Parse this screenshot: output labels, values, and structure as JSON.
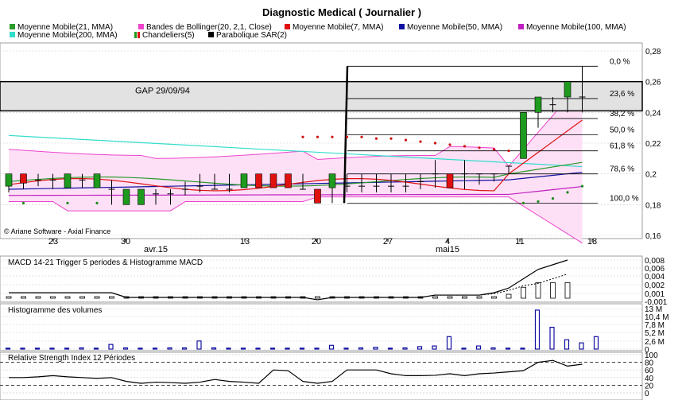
{
  "chart_data": {
    "type": "candlestick",
    "title": "Diagnostic Medical  ( Journalier )",
    "copyright": "© Ariane Software - Axial Finance",
    "colors": {
      "mm21": "#2a9a2a",
      "bollinger": "#ee44cc",
      "bollinger_fill": "#fde0f6",
      "mm7": "#e01010",
      "mm50": "#1010a0",
      "mm100": "#c020c0",
      "mm200": "#33ddcc",
      "candle_up": "#1e9a1e",
      "candle_down": "#e01010",
      "sar": "#000000"
    },
    "legend": {
      "row1": [
        {
          "key": "mm21",
          "label": "Moyenne Mobile(21, MMA)"
        },
        {
          "key": "bollinger",
          "label": "Bandes de Bollinger(20, 2,1, Close)"
        },
        {
          "key": "mm7",
          "label": "Moyenne Mobile(7, MMA)"
        },
        {
          "key": "mm50",
          "label": "Moyenne Mobile(50, MMA)"
        },
        {
          "key": "mm100",
          "label": "Moyenne Mobile(100, MMA)"
        }
      ],
      "row2": [
        {
          "key": "mm200",
          "label": "Moyenne Mobile(200, MMA)"
        },
        {
          "key": "candles",
          "label": "Chandeliers(5)"
        },
        {
          "key": "sar",
          "label": "Parabolique SAR(2)"
        }
      ]
    },
    "price_axis": {
      "ticks": [
        "0,28",
        "0,26",
        "0,24",
        "0,22",
        "0,2",
        "0,18",
        "0,16"
      ],
      "ylim": [
        0.16,
        0.29
      ]
    },
    "x_axis": {
      "ticks": [
        "23",
        "30",
        "13",
        "20",
        "27",
        "4",
        "11",
        "18"
      ],
      "months": [
        "avr.15",
        "mai15"
      ]
    },
    "gap_label": "GAP 29/09/94",
    "gap_range": [
      0.241,
      0.26
    ],
    "fibonacci": {
      "low": 0.181,
      "high": 0.27,
      "levels": [
        {
          "label": "0,0 %",
          "value": 0.27
        },
        {
          "label": "23,6 %",
          "value": 0.249
        },
        {
          "label": "38,2 %",
          "value": 0.236
        },
        {
          "label": "50,0 %",
          "value": 0.2255
        },
        {
          "label": "61,8 %",
          "value": 0.215
        },
        {
          "label": "78,6 %",
          "value": 0.2
        },
        {
          "label": "100,0 %",
          "value": 0.181
        }
      ]
    },
    "candles": [
      {
        "o": 0.192,
        "h": 0.2,
        "l": 0.188,
        "c": 0.2
      },
      {
        "o": 0.2,
        "h": 0.2,
        "l": 0.19,
        "c": 0.194
      },
      {
        "o": 0.196,
        "h": 0.2,
        "l": 0.192,
        "c": 0.196
      },
      {
        "o": 0.196,
        "h": 0.2,
        "l": 0.19,
        "c": 0.196
      },
      {
        "o": 0.191,
        "h": 0.2,
        "l": 0.191,
        "c": 0.2
      },
      {
        "o": 0.196,
        "h": 0.2,
        "l": 0.191,
        "c": 0.196
      },
      {
        "o": 0.191,
        "h": 0.2,
        "l": 0.191,
        "c": 0.2
      },
      {
        "o": 0.19,
        "h": 0.196,
        "l": 0.18,
        "c": 0.19
      },
      {
        "o": 0.18,
        "h": 0.19,
        "l": 0.18,
        "c": 0.19
      },
      {
        "o": 0.18,
        "h": 0.19,
        "l": 0.18,
        "c": 0.19
      },
      {
        "o": 0.187,
        "h": 0.19,
        "l": 0.18,
        "c": 0.187
      },
      {
        "o": 0.187,
        "h": 0.19,
        "l": 0.18,
        "c": 0.187
      },
      {
        "o": 0.19,
        "h": 0.195,
        "l": 0.186,
        "c": 0.19
      },
      {
        "o": 0.192,
        "h": 0.2,
        "l": 0.188,
        "c": 0.192
      },
      {
        "o": 0.19,
        "h": 0.2,
        "l": 0.19,
        "c": 0.19
      },
      {
        "o": 0.19,
        "h": 0.2,
        "l": 0.188,
        "c": 0.19
      },
      {
        "o": 0.191,
        "h": 0.2,
        "l": 0.191,
        "c": 0.2
      },
      {
        "o": 0.2,
        "h": 0.2,
        "l": 0.191,
        "c": 0.191
      },
      {
        "o": 0.2,
        "h": 0.2,
        "l": 0.191,
        "c": 0.191
      },
      {
        "o": 0.2,
        "h": 0.2,
        "l": 0.191,
        "c": 0.191
      },
      {
        "o": 0.19,
        "h": 0.2,
        "l": 0.19,
        "c": 0.19
      },
      {
        "o": 0.19,
        "h": 0.19,
        "l": 0.181,
        "c": 0.181
      },
      {
        "o": 0.191,
        "h": 0.2,
        "l": 0.181,
        "c": 0.2
      },
      {
        "o": 0.192,
        "h": 0.2,
        "l": 0.188,
        "c": 0.192
      },
      {
        "o": 0.192,
        "h": 0.2,
        "l": 0.188,
        "c": 0.192
      },
      {
        "o": 0.192,
        "h": 0.2,
        "l": 0.188,
        "c": 0.192
      },
      {
        "o": 0.192,
        "h": 0.2,
        "l": 0.188,
        "c": 0.192
      },
      {
        "o": 0.192,
        "h": 0.2,
        "l": 0.188,
        "c": 0.192
      },
      {
        "o": 0.195,
        "h": 0.2,
        "l": 0.19,
        "c": 0.195
      },
      {
        "o": 0.2,
        "h": 0.209,
        "l": 0.191,
        "c": 0.2
      },
      {
        "o": 0.2,
        "h": 0.2,
        "l": 0.191,
        "c": 0.191
      },
      {
        "o": 0.2,
        "h": 0.209,
        "l": 0.19,
        "c": 0.2
      },
      {
        "o": 0.2,
        "h": 0.2,
        "l": 0.193,
        "c": 0.2
      },
      {
        "o": 0.2,
        "h": 0.2,
        "l": 0.195,
        "c": 0.2
      },
      {
        "o": 0.205,
        "h": 0.205,
        "l": 0.2,
        "c": 0.205
      },
      {
        "o": 0.21,
        "h": 0.24,
        "l": 0.21,
        "c": 0.24
      },
      {
        "o": 0.24,
        "h": 0.25,
        "l": 0.23,
        "c": 0.25
      },
      {
        "o": 0.245,
        "h": 0.25,
        "l": 0.24,
        "c": 0.245
      },
      {
        "o": 0.25,
        "h": 0.26,
        "l": 0.24,
        "c": 0.26
      },
      {
        "o": 0.25,
        "h": 0.27,
        "l": 0.24,
        "c": 0.25
      }
    ],
    "sar": [
      null,
      0.181,
      null,
      null,
      0.181,
      null,
      0.181,
      null,
      null,
      null,
      null,
      null,
      null,
      null,
      null,
      null,
      null,
      null,
      null,
      null,
      0.224,
      0.224,
      0.224,
      0.224,
      0.224,
      0.223,
      0.223,
      0.222,
      0.221,
      0.22,
      0.219,
      0.218,
      0.217,
      0.216,
      0.215,
      0.181,
      0.182,
      0.184,
      0.188,
      0.192
    ],
    "macd_panel": {
      "label": "MACD 14-21   Trigger 5 periodes & Histogramme MACD",
      "ticks": [
        "0,008",
        "0,006",
        "0,004",
        "0,002",
        "0,001",
        "-0,001"
      ],
      "macd": [
        0.001,
        0.001,
        0.001,
        0.001,
        0.001,
        0.001,
        0.001,
        0.001,
        0,
        0,
        0,
        0,
        0,
        0,
        0,
        0,
        0,
        0,
        0,
        0,
        0,
        -0.0005,
        0,
        0,
        0,
        0,
        0,
        0,
        0,
        0.0005,
        0.0005,
        0.0005,
        0.0005,
        0.001,
        0.002,
        0.004,
        0.006,
        0.007,
        0.008
      ],
      "trigger": [
        0.001,
        0.001,
        0.001,
        0.001,
        0.001,
        0.001,
        0.001,
        0.001,
        0,
        0,
        0,
        0,
        0,
        0,
        0,
        0,
        0,
        0,
        0,
        0,
        0,
        -0.0005,
        0,
        0,
        0,
        0,
        0,
        0,
        0,
        0.0005,
        0.0005,
        0.0005,
        0.0005,
        0.0008,
        0.0015,
        0.0025,
        0.003,
        0.004,
        0.005
      ],
      "hist": [
        0,
        0,
        0,
        0,
        0,
        0,
        0,
        0,
        0,
        0,
        0,
        0,
        0,
        0,
        0,
        0,
        0,
        0,
        0,
        0,
        0,
        0,
        0,
        0,
        0,
        0,
        0,
        0,
        0,
        0,
        0,
        0,
        0,
        0,
        0.0005,
        0.002,
        0.003,
        0.003,
        0.003
      ]
    },
    "volume_panel": {
      "label": "Histogramme des volumes",
      "ticks": [
        "13 M",
        "10,4 M",
        "7,8 M",
        "5,2 M",
        "2,6 M",
        "0"
      ],
      "values": [
        0.3,
        0.3,
        0.3,
        0.3,
        0.3,
        0.4,
        0.3,
        1.5,
        0.4,
        0.3,
        0.3,
        0.4,
        0.4,
        2.6,
        0.4,
        0.3,
        0.3,
        0.3,
        0.3,
        0.3,
        0.3,
        0.3,
        1.2,
        0.3,
        0.4,
        0.6,
        0.3,
        0.4,
        0.8,
        1.0,
        4.0,
        0.3,
        1.0,
        0.4,
        0.3,
        0.3,
        12.5,
        7.0,
        3.0,
        2.0,
        4.0
      ]
    },
    "rsi_panel": {
      "label": "Relative Strength Index 12 Périodes",
      "ticks": [
        "100",
        "80",
        "60",
        "40",
        "20",
        "0"
      ],
      "values": [
        40,
        40,
        42,
        45,
        42,
        40,
        38,
        40,
        30,
        25,
        28,
        27,
        25,
        28,
        35,
        30,
        28,
        25,
        60,
        58,
        30,
        25,
        30,
        60,
        60,
        60,
        50,
        45,
        45,
        46,
        50,
        45,
        50,
        52,
        55,
        58,
        80,
        85,
        70,
        75
      ]
    }
  }
}
